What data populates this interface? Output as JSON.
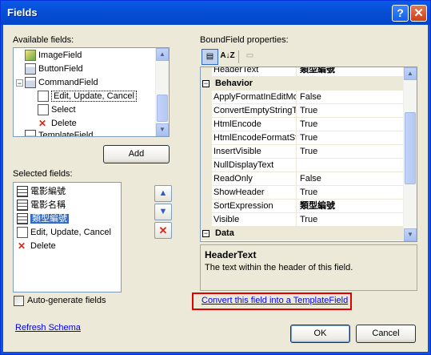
{
  "window": {
    "title": "Fields"
  },
  "titlebar": {
    "help_glyph": "?",
    "close_glyph": "✕"
  },
  "available": {
    "label": "Available fields:",
    "items": [
      {
        "label": "ImageField",
        "icon": "image-field-icon"
      },
      {
        "label": "ButtonField",
        "icon": "button-field-icon"
      },
      {
        "label": "CommandField",
        "icon": "command-field-icon",
        "expander": "−"
      },
      {
        "label": "Edit, Update, Cancel",
        "icon": "edit-icon",
        "selected": true
      },
      {
        "label": "Select",
        "icon": "select-icon"
      },
      {
        "label": "Delete",
        "icon": "delete-icon"
      },
      {
        "label": "TemplateField",
        "icon": "template-field-icon"
      }
    ],
    "add_button": "Add"
  },
  "selected": {
    "label": "Selected fields:",
    "items": [
      {
        "label": "電影編號",
        "icon": "bound-field-icon"
      },
      {
        "label": "電影名稱",
        "icon": "bound-field-icon"
      },
      {
        "label": "類型編號",
        "icon": "bound-field-icon",
        "selected": true
      },
      {
        "label": "Edit, Update, Cancel",
        "icon": "edit-icon"
      },
      {
        "label": "Delete",
        "icon": "delete-icon"
      }
    ],
    "move_up": "▲",
    "move_down": "▼",
    "remove": "✕"
  },
  "autogen": {
    "label": "Auto-generate fields",
    "checked": false
  },
  "refresh_link": "Refresh Schema",
  "properties": {
    "label": "BoundField properties:",
    "toolbar": {
      "categorized": "categorized-icon",
      "alphabetical": "A↓Z",
      "pages": "property-pages-icon"
    },
    "rows": [
      {
        "kind": "prop",
        "name": "HeaderText",
        "value": "類型編號",
        "bold": true,
        "partial": true
      },
      {
        "kind": "cat",
        "name": "Behavior",
        "expander": "−"
      },
      {
        "kind": "prop",
        "name": "ApplyFormatInEditMo",
        "value": "False"
      },
      {
        "kind": "prop",
        "name": "ConvertEmptyStringT",
        "value": "True"
      },
      {
        "kind": "prop",
        "name": "HtmlEncode",
        "value": "True"
      },
      {
        "kind": "prop",
        "name": "HtmlEncodeFormatStr",
        "value": "True"
      },
      {
        "kind": "prop",
        "name": "InsertVisible",
        "value": "True"
      },
      {
        "kind": "prop",
        "name": "NullDisplayText",
        "value": ""
      },
      {
        "kind": "prop",
        "name": "ReadOnly",
        "value": "False"
      },
      {
        "kind": "prop",
        "name": "ShowHeader",
        "value": "True"
      },
      {
        "kind": "prop",
        "name": "SortExpression",
        "value": "類型編號",
        "bold": true
      },
      {
        "kind": "prop",
        "name": "Visible",
        "value": "True"
      },
      {
        "kind": "cat",
        "name": "Data",
        "expander": "−"
      }
    ],
    "description_title": "HeaderText",
    "description_text": "The text within the header of this field."
  },
  "convert_link": "Convert this field into a TemplateField",
  "accent": {
    "link": "#0000ee",
    "highlight_border": "#e00000",
    "selection": "#316ac5"
  },
  "buttons": {
    "ok": "OK",
    "cancel": "Cancel"
  }
}
